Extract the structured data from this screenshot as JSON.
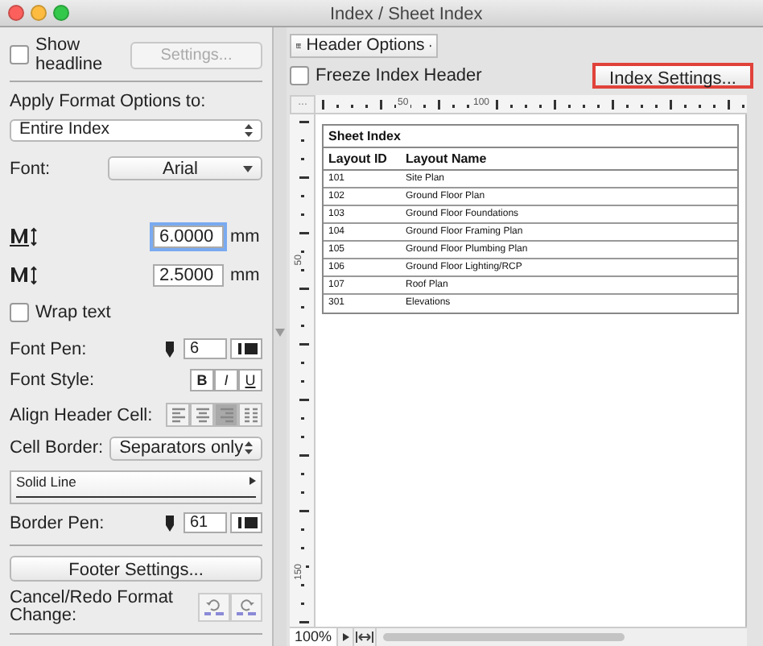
{
  "window": {
    "title": "Index / Sheet Index"
  },
  "left_panel": {
    "show_headline": {
      "label": "Show headline",
      "checked": false
    },
    "settings_button": {
      "label": "Settings...",
      "disabled": true
    },
    "apply_label": "Apply Format Options to:",
    "apply_select": "Entire Index",
    "font_label": "Font:",
    "font_value": "Arial",
    "size_fields": [
      {
        "value": "6.0000",
        "unit": "mm",
        "focused": true
      },
      {
        "value": "2.5000",
        "unit": "mm",
        "focused": false
      }
    ],
    "wrap_text": {
      "label": "Wrap text",
      "checked": false
    },
    "font_pen": {
      "label": "Font Pen:",
      "value": "6"
    },
    "font_style": {
      "label": "Font Style:",
      "buttons": [
        {
          "label": "B",
          "selected": false
        },
        {
          "label": "I",
          "selected": false
        },
        {
          "label": "U",
          "selected": false
        }
      ]
    },
    "align_header": {
      "label": "Align Header Cell:",
      "options": [
        {
          "selected": false
        },
        {
          "selected": false
        },
        {
          "selected": true
        },
        {
          "selected": false
        }
      ]
    },
    "cell_border": {
      "label": "Cell Border:",
      "value": "Separators only"
    },
    "line_type": "Solid Line",
    "border_pen": {
      "label": "Border Pen:",
      "value": "61"
    },
    "footer_button": "Footer Settings...",
    "cancel_redo_label": "Cancel/Redo Format Change:"
  },
  "right_panel": {
    "header_options": "Header Options",
    "freeze_header": {
      "label": "Freeze Index Header",
      "checked": false
    },
    "index_settings": {
      "label": "Index Settings...",
      "highlighted": true
    },
    "ruler_corner": "...",
    "h_ruler_labels": [
      "50",
      "100"
    ],
    "v_ruler_labels": [
      "50",
      "150"
    ],
    "table": {
      "title": "Sheet Index",
      "columns": [
        "Layout ID",
        "Layout Name"
      ],
      "rows": [
        [
          "101",
          "Site Plan"
        ],
        [
          "102",
          "Ground Floor Plan"
        ],
        [
          "103",
          "Ground Floor Foundations"
        ],
        [
          "104",
          "Ground Floor Framing Plan"
        ],
        [
          "105",
          "Ground Floor Plumbing Plan"
        ],
        [
          "106",
          "Ground Floor Lighting/RCP"
        ],
        [
          "107",
          "Roof Plan"
        ],
        [
          "301",
          "Elevations"
        ]
      ]
    },
    "zoom": "100%"
  }
}
